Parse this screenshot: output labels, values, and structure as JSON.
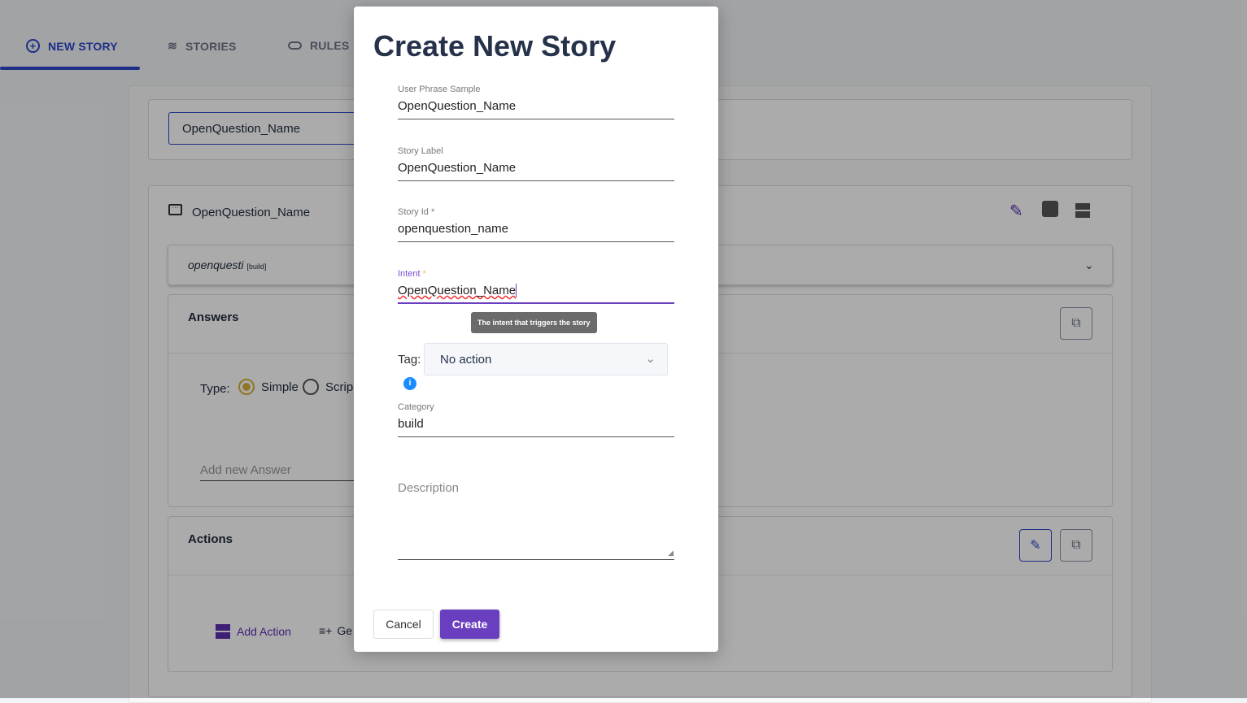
{
  "tabs": [
    {
      "label": "NEW STORY",
      "icon": "plus-circle-icon",
      "active": true
    },
    {
      "label": "STORIES",
      "icon": "layers-icon"
    },
    {
      "label": "RULES",
      "icon": "toggle-icon"
    }
  ],
  "search": {
    "value": "OpenQuestion_Name"
  },
  "story": {
    "title": "OpenQuestion_Name",
    "intent_row": "openquesti",
    "intent_tag": "[build]",
    "answers": {
      "title": "Answers",
      "type_label": "Type:",
      "options": [
        "Simple",
        "Scrip"
      ],
      "selected": "Simple",
      "add_placeholder": "Add new Answer"
    },
    "actions": {
      "title": "Actions",
      "add_action": "Add Action",
      "generate": "Ge"
    }
  },
  "modal": {
    "title": "Create New Story",
    "fields": [
      {
        "label": "User Phrase Sample",
        "value": "OpenQuestion_Name"
      },
      {
        "label": "Story Label",
        "value": "OpenQuestion_Name"
      },
      {
        "label": "Story Id *",
        "value": "openquestion_name"
      },
      {
        "label": "Intent",
        "required": "*",
        "value": "OpenQuestion_Name"
      }
    ],
    "tooltip": "The intent that triggers the story",
    "tag_label": "Tag:",
    "tag_value": "No action",
    "category_label": "Category",
    "category_value": "build",
    "description_placeholder": "Description",
    "cancel": "Cancel",
    "create": "Create"
  },
  "colors": {
    "accent": "#6a3fbf",
    "primary": "#2c46c8",
    "radio": "#d4b23a",
    "info": "#1a8cff"
  }
}
